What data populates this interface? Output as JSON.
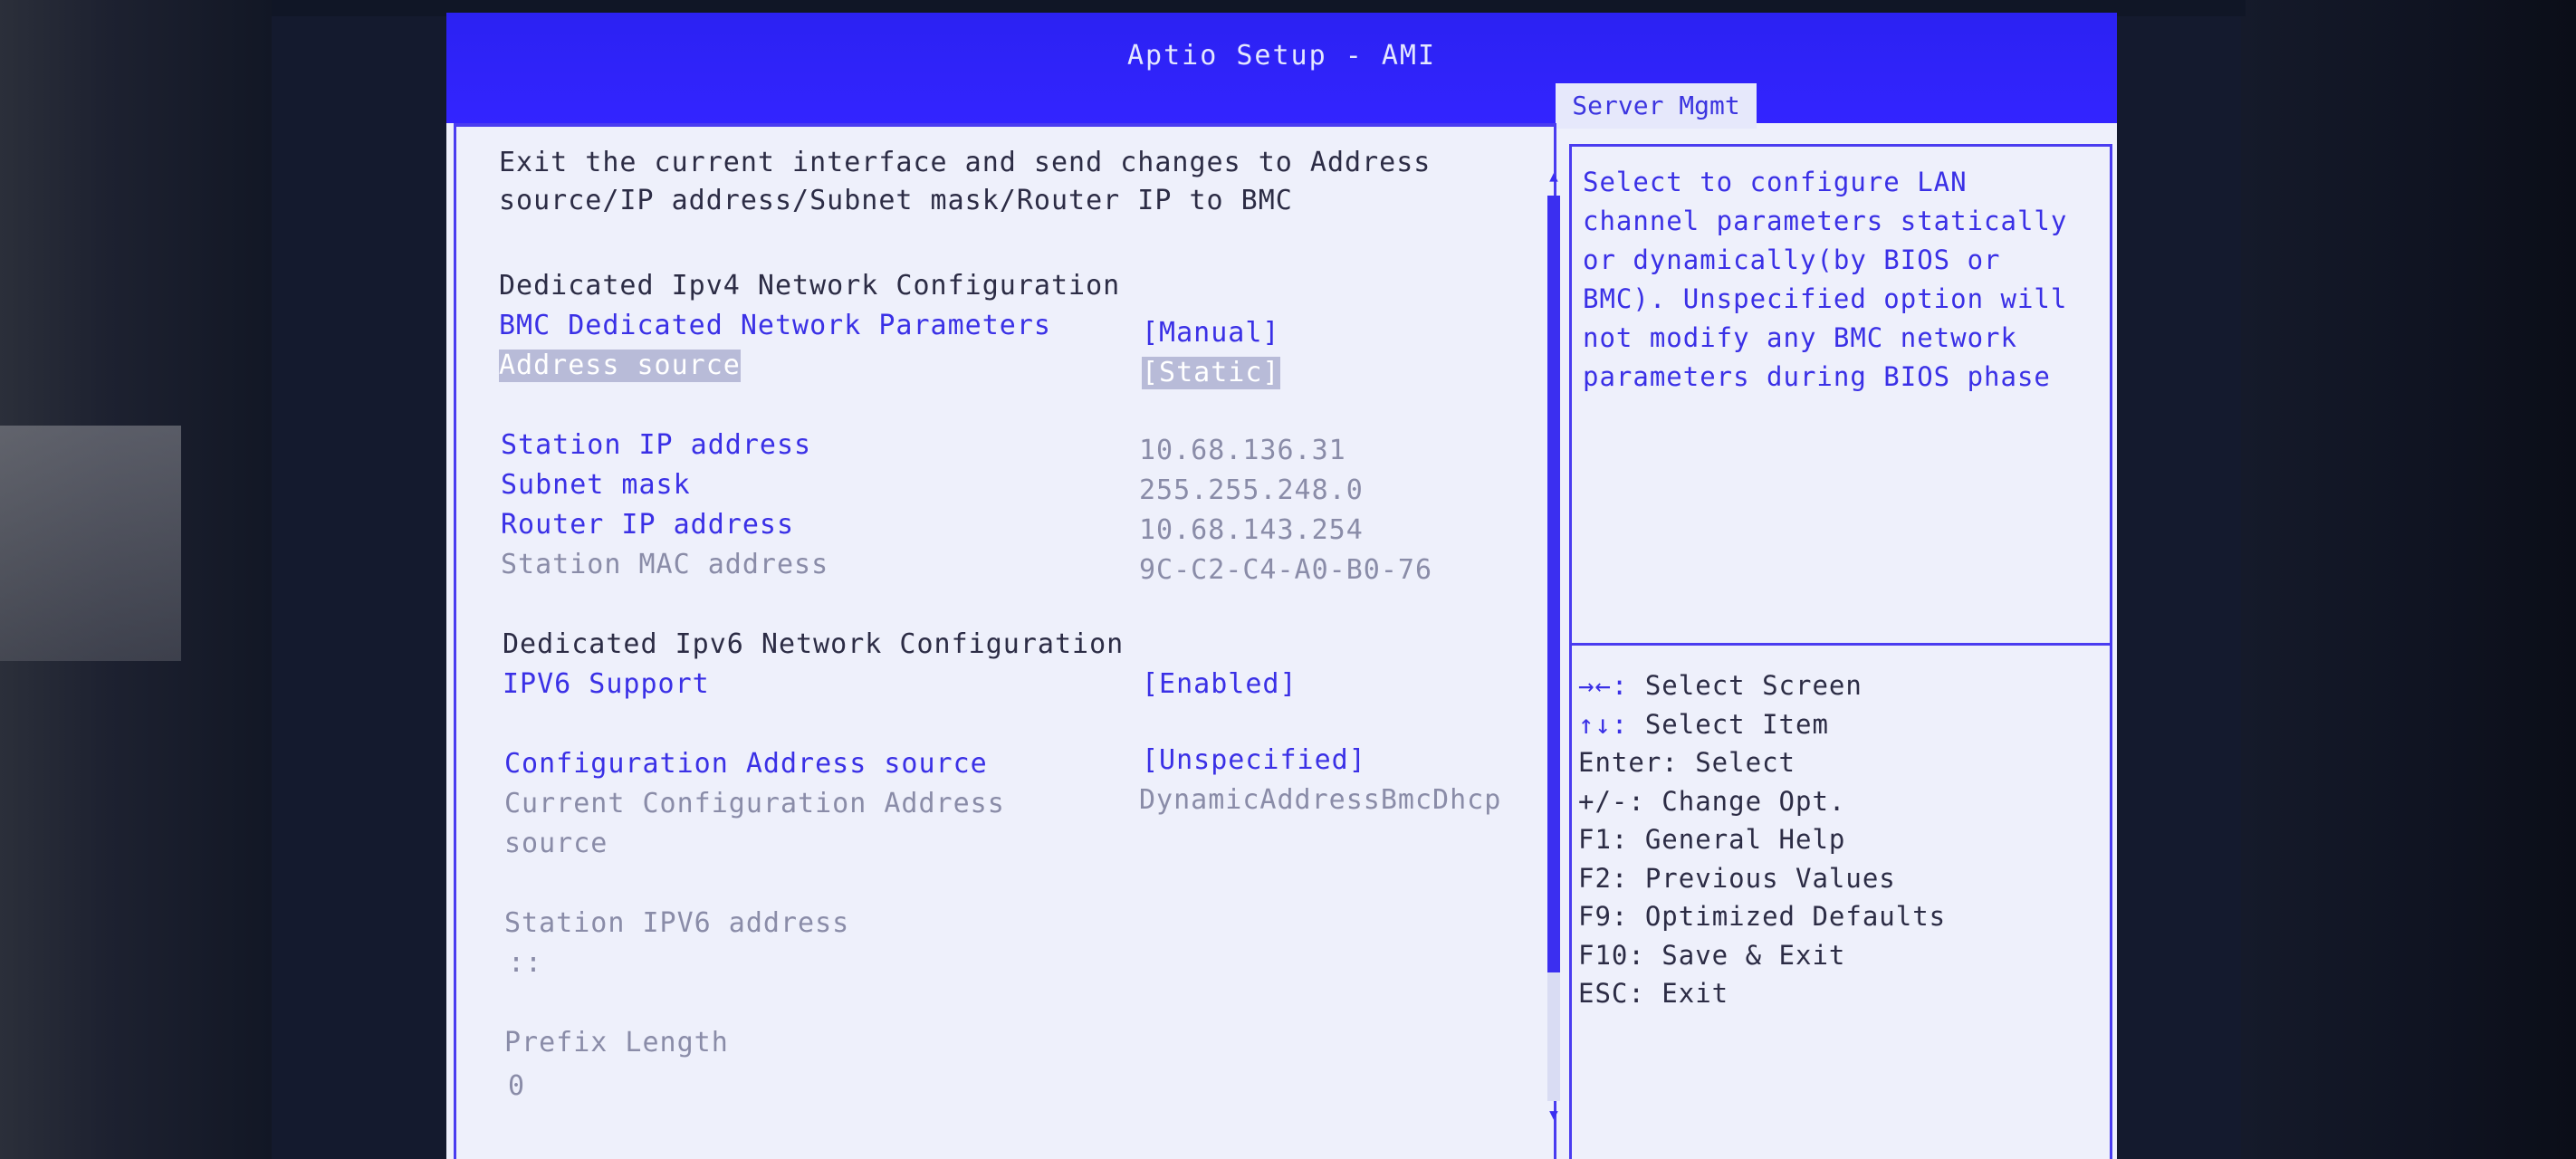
{
  "title": "Aptio Setup - AMI",
  "tab": "Server Mgmt",
  "description": [
    "Exit the current interface and send changes to Address",
    "source/IP address/Subnet mask/Router IP to BMC"
  ],
  "ipv4": {
    "heading": "Dedicated Ipv4 Network Configuration",
    "bmc_params_label": "BMC Dedicated Network Parameters",
    "bmc_params_value": "[Manual]",
    "address_source_label": "Address source",
    "address_source_value": "[Static]",
    "station_ip_label": "Station IP address",
    "station_ip_value": "10.68.136.31",
    "subnet_label": "Subnet mask",
    "subnet_value": "255.255.248.0",
    "router_label": "Router IP address",
    "router_value": "10.68.143.254",
    "mac_label": "Station MAC address",
    "mac_value": "9C-C2-C4-A0-B0-76"
  },
  "ipv6": {
    "heading": "Dedicated Ipv6 Network Configuration",
    "support_label": "IPV6 Support",
    "support_value": "[Enabled]",
    "config_source_label": "Configuration Address source",
    "config_source_value": "[Unspecified]",
    "current_config_label_1": "Current Configuration Address",
    "current_config_label_2": "source",
    "current_config_value": "DynamicAddressBmcDhcp",
    "station_ipv6_label": "Station IPV6 address",
    "station_ipv6_value": "::",
    "prefix_label": "Prefix Length",
    "prefix_value": "0"
  },
  "help": "Select to configure LAN\nchannel parameters statically\nor dynamically(by BIOS or\nBMC). Unspecified option will\nnot modify any BMC network\nparameters during BIOS phase",
  "keys": [
    {
      "key": "→←:",
      "desc": " Select Screen"
    },
    {
      "key": "↑↓:",
      "desc": " Select Item"
    },
    {
      "key": "Enter:",
      "desc": " Select"
    },
    {
      "key": "+/-:",
      "desc": " Change Opt."
    },
    {
      "key": "F1:",
      "desc": " General Help"
    },
    {
      "key": "F2:",
      "desc": " Previous Values"
    },
    {
      "key": "F9:",
      "desc": " Optimized Defaults"
    },
    {
      "key": "F10:",
      "desc": " Save & Exit"
    },
    {
      "key": "ESC:",
      "desc": " Exit"
    }
  ],
  "colors": {
    "title_bar": "#3324ff",
    "screen_bg": "#eef0fb",
    "accent": "#3a30e6"
  }
}
